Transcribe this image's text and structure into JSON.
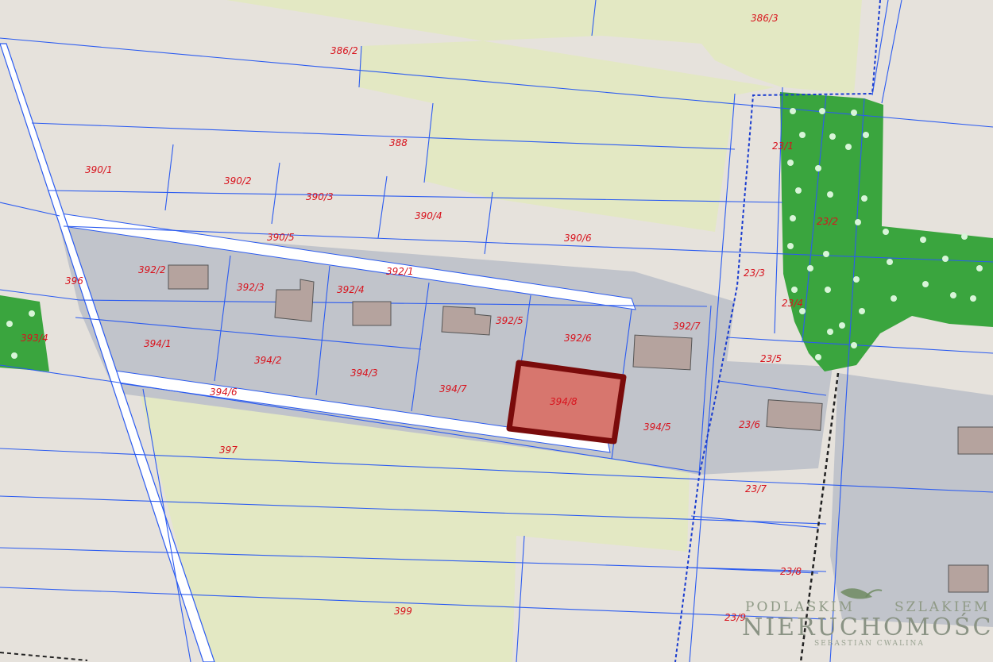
{
  "map": {
    "colors": {
      "background": "#e6e2dc",
      "farmland": "#e3e8c3",
      "built_area": "#c1c4cb",
      "forest": "#3aa53e",
      "building": "#b5a39e",
      "highlight_fill": "#d7766e",
      "highlight_border": "#7a0b0b",
      "parcel_line": "#2b5bf0",
      "label": "#d8141e"
    },
    "selected_parcel": "394/8",
    "parcels": {
      "p386_2": "386/2",
      "p386_3": "386/3",
      "p388": "388",
      "p390_1": "390/1",
      "p390_2": "390/2",
      "p390_3": "390/3",
      "p390_4": "390/4",
      "p390_5": "390/5",
      "p390_6": "390/6",
      "p392_1": "392/1",
      "p392_2": "392/2",
      "p392_3": "392/3",
      "p392_4": "392/4",
      "p392_5": "392/5",
      "p392_6": "392/6",
      "p392_7": "392/7",
      "p393_4": "393/4",
      "p394_1": "394/1",
      "p394_2": "394/2",
      "p394_3": "394/3",
      "p394_5": "394/5",
      "p394_6": "394/6",
      "p394_7": "394/7",
      "p394_8": "394/8",
      "p396": "396",
      "p397": "397",
      "p399": "399",
      "p23_1": "23/1",
      "p23_2": "23/2",
      "p23_3": "23/3",
      "p23_4": "23/4",
      "p23_5": "23/5",
      "p23_6": "23/6",
      "p23_7": "23/7",
      "p23_8": "23/8",
      "p23_9": "23/9"
    }
  },
  "watermark": {
    "top_left": "PODLASKIM",
    "top_right": "SZLAKIEM",
    "main": "NIERUCHOMOŚCI",
    "author": "SEBASTIAN CWALINA"
  }
}
